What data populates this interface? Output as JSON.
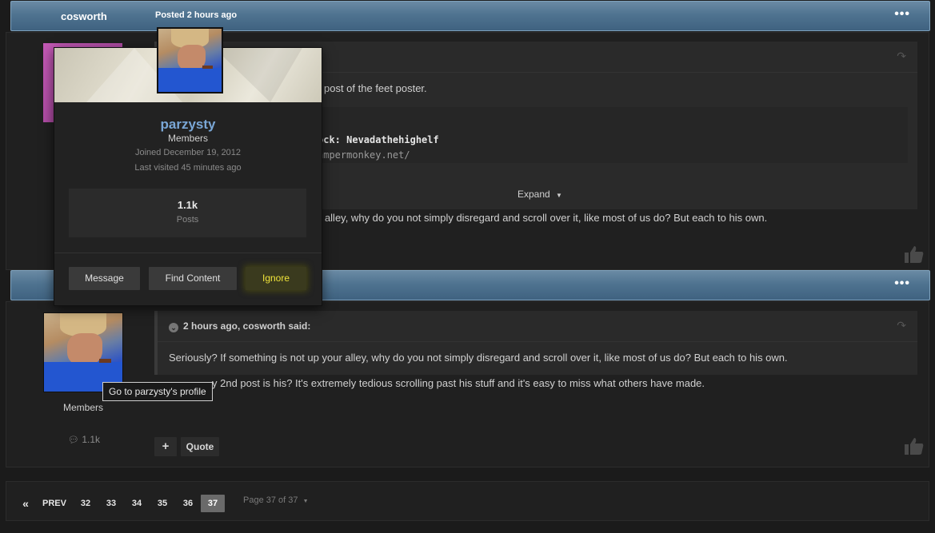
{
  "post1": {
    "author": "cosworth",
    "posted": "Posted 2 hours ago",
    "menu": "•••",
    "text_feet": "post of the feet poster.",
    "code_line1": "ock: Nevadathehighelf",
    "code_line2": "ampermonkey.net/",
    "expand": "Expand",
    "reply_text": "r alley, why do you not simply disregard and scroll over it, like most of us do? But each to his own."
  },
  "card": {
    "name": "parzysty",
    "group": "Members",
    "joined": "Joined December 19, 2012",
    "last_visited": "Last visited 45 minutes ago",
    "posts_value": "1.1k",
    "posts_label": "Posts",
    "btn_message": "Message",
    "btn_find": "Find Content",
    "btn_ignore": "Ignore"
  },
  "post2": {
    "menu": "•••",
    "cite": "2 hours ago, cosworth said:",
    "quote_text": "Seriously? If something is not up your alley, why do you not simply disregard and scroll over it, like most of us do? But each to his own.",
    "reply_text": "y 2nd post is his? It's extremely tedious scrolling past his stuff and it's easy to miss what others have made.",
    "author_group": "Members",
    "author_posts": "1.1k",
    "tooltip": "Go to parzysty's profile",
    "btn_plus": "+",
    "btn_quote": "Quote"
  },
  "pagination": {
    "first": "«",
    "prev": "PREV",
    "pages": [
      "32",
      "33",
      "34",
      "35",
      "36",
      "37"
    ],
    "current": "37",
    "info": "Page 37 of 37"
  }
}
